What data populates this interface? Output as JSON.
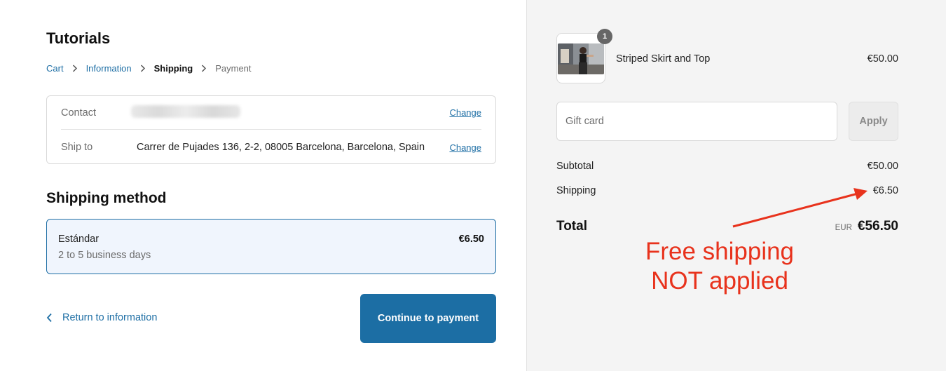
{
  "store": {
    "title": "Tutorials"
  },
  "breadcrumb": [
    {
      "label": "Cart"
    },
    {
      "label": "Information"
    },
    {
      "label": "Shipping"
    },
    {
      "label": "Payment"
    }
  ],
  "review": {
    "contact_label": "Contact",
    "contact_value": "",
    "ship_to_label": "Ship to",
    "ship_to_value": "Carrer de Pujades 136, 2-2, 08005 Barcelona, Barcelona, Spain",
    "change_label": "Change"
  },
  "shipping_method": {
    "title": "Shipping method",
    "name": "Estándar",
    "description": "2 to 5 business days",
    "price": "€6.50"
  },
  "actions": {
    "return_label": "Return to information",
    "continue_label": "Continue to payment"
  },
  "order": {
    "product_name": "Striped Skirt and Top",
    "product_price": "€50.00",
    "quantity": "1",
    "gift_placeholder": "Gift card",
    "apply_label": "Apply",
    "subtotal_label": "Subtotal",
    "subtotal_value": "€50.00",
    "shipping_label": "Shipping",
    "shipping_value": "€6.50",
    "total_label": "Total",
    "currency": "EUR",
    "total_value": "€56.50"
  },
  "annotation": {
    "line1": "Free shipping",
    "line2": "NOT applied",
    "color": "#e8321c"
  },
  "colors": {
    "accent": "#1c6ea4",
    "link": "#1f6fa5",
    "sidebar_bg": "#f4f4f4",
    "selected_bg": "#f0f5fd"
  }
}
